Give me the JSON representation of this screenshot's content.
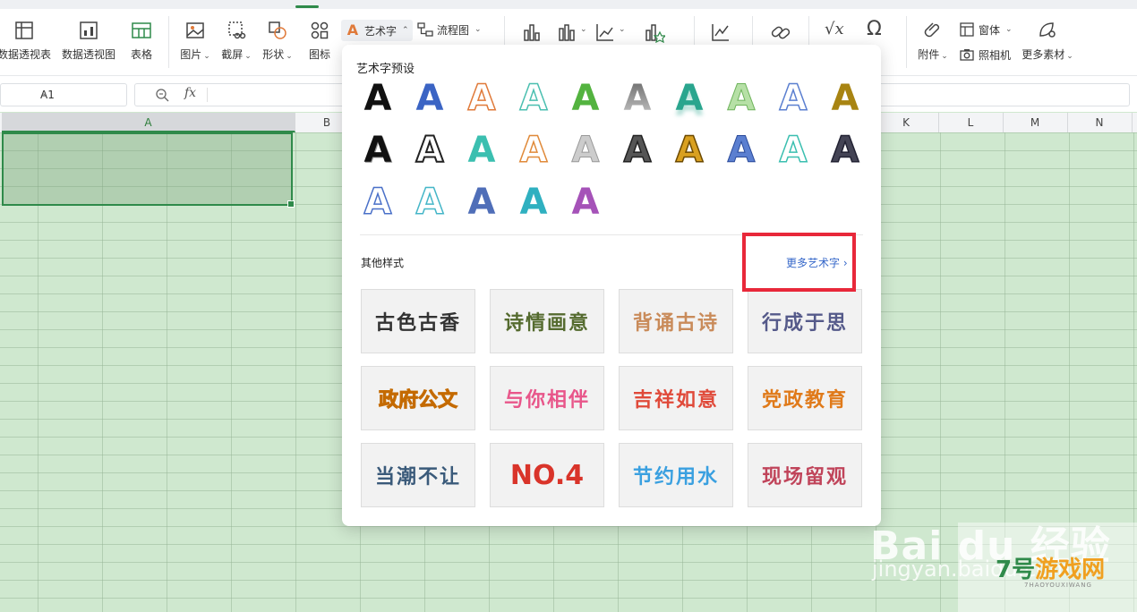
{
  "ribbon": {
    "pivot_table": "数据透视表",
    "pivot_chart": "数据透视图",
    "table": "表格",
    "picture": "图片",
    "screenshot": "截屏",
    "shape": "形状",
    "icon": "图标",
    "wordart": "艺术字",
    "flowchart": "流程图",
    "attachment": "附件",
    "form": "窗体",
    "camera": "照相机",
    "more_material": "更多素材"
  },
  "formula_bar": {
    "cell_ref": "A1",
    "fx": "fx"
  },
  "columns": {
    "a": "A",
    "b": "B",
    "k": "K",
    "l": "L",
    "m": "M",
    "n": "N"
  },
  "panel": {
    "preset_title": "艺术字预设",
    "preset_letter": "A",
    "other_styles": "其他样式",
    "more_wordart": "更多艺术字",
    "styles": [
      "古色古香",
      "诗情画意",
      "背诵古诗",
      "行成于思",
      "政府公文",
      "与你相伴",
      "吉祥如意",
      "党政教育",
      "当潮不让",
      "NO.4",
      "节约用水",
      "现场留观"
    ]
  },
  "watermark": {
    "baidu": "Bai du 经验",
    "url": "jingyan.baidu.com",
    "site_num": "7号",
    "site_name": "游戏网",
    "site_pinyin": "7HAOYOUXIWANG"
  },
  "colors": {
    "accent": "#2f8a4a",
    "highlight": "#e8283a",
    "link": "#3567c9"
  }
}
